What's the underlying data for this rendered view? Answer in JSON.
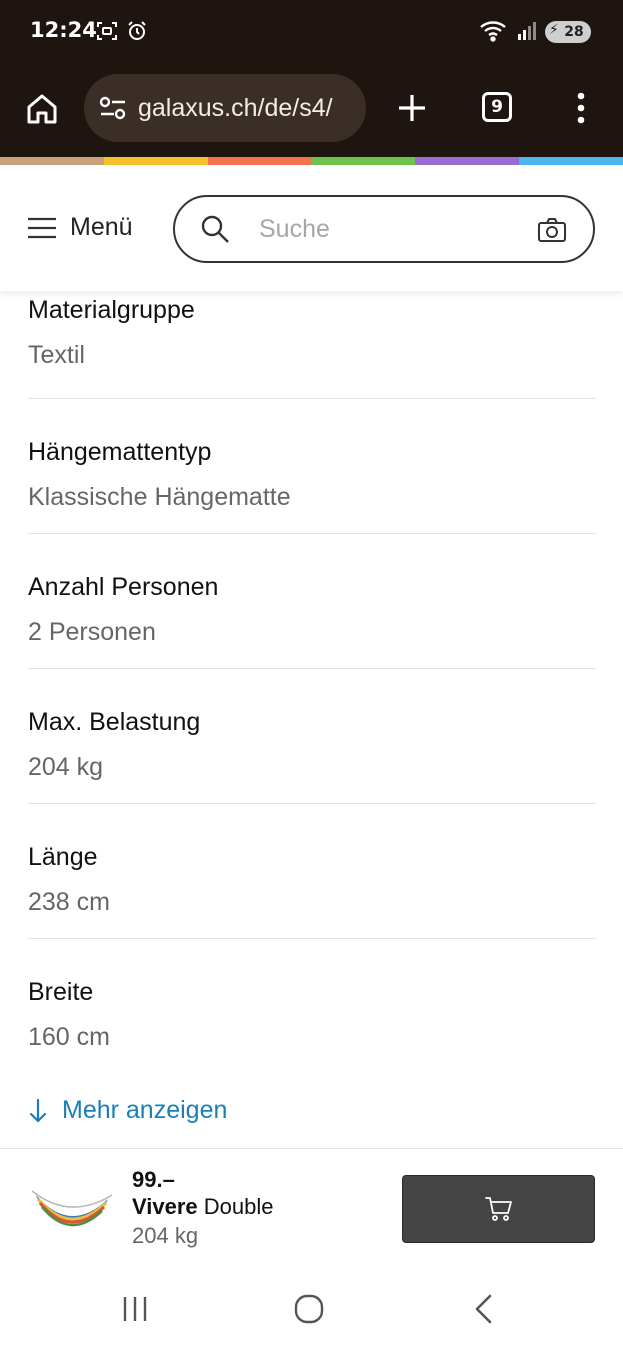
{
  "status_bar": {
    "time": "12:24",
    "battery_level": "28",
    "icons": [
      "screenshot-icon",
      "alarm-icon",
      "wifi-icon",
      "signal-icon",
      "battery-icon"
    ]
  },
  "browser": {
    "url": "galaxus.ch/de/s4/",
    "tab_count": "9"
  },
  "brand_colors": [
    "#c9a27a",
    "#f5c02b",
    "#f2744f",
    "#6cc24a",
    "#9b6cd1",
    "#4eb6ec"
  ],
  "header": {
    "menu_label": "Menü",
    "search_placeholder": "Suche"
  },
  "specs": [
    {
      "label": "Materialgruppe",
      "value": "Textil"
    },
    {
      "label": "Hängemattentyp",
      "value": "Klassische Hängematte"
    },
    {
      "label": "Anzahl Personen",
      "value": "2 Personen"
    },
    {
      "label": "Max. Belastung",
      "value": "204 kg"
    },
    {
      "label": "Länge",
      "value": "238 cm"
    },
    {
      "label": "Breite",
      "value": "160 cm"
    }
  ],
  "more_link": "Mehr anzeigen",
  "product": {
    "price": "99.–",
    "brand": "Vivere",
    "name": "Double",
    "subtitle": "204 kg"
  },
  "accent_color": "#1a7fb6"
}
